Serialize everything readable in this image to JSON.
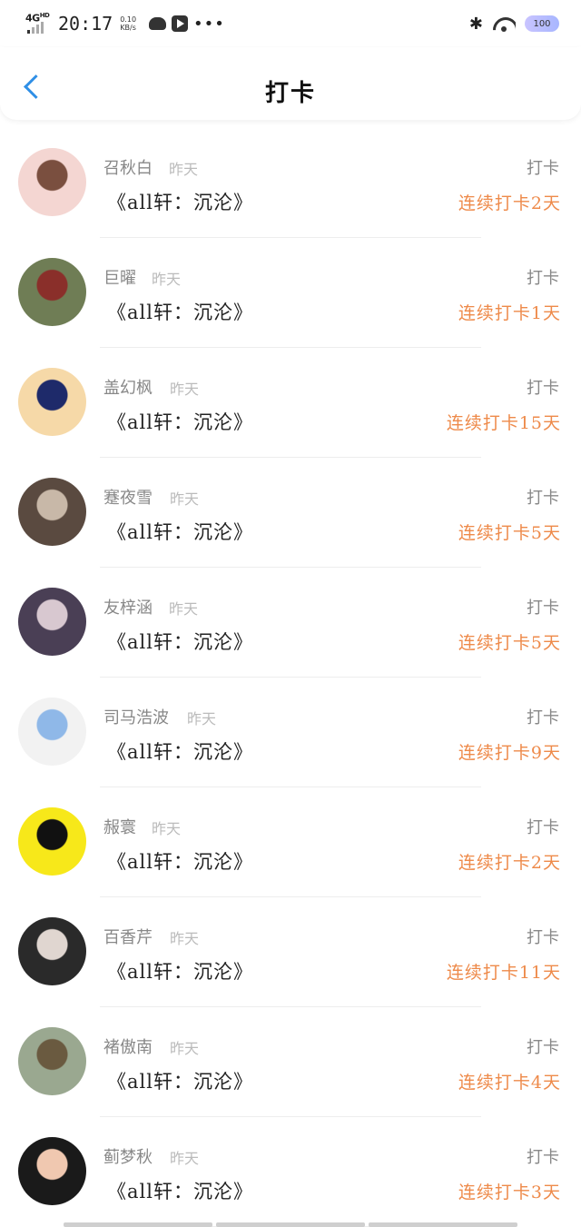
{
  "status_bar": {
    "network": "4G",
    "network_sub": "HD",
    "time": "20:17",
    "speed_value": "0.10",
    "speed_unit": "KB/s",
    "more": "•••",
    "bluetooth": "✱",
    "battery": "100"
  },
  "header": {
    "title": "打卡",
    "back_icon": "chevron-left-icon",
    "accent_color": "#2f8fe6"
  },
  "streak_color": "#ee8a4a",
  "items": [
    {
      "name": "召秋白",
      "time": "昨天",
      "book": "《all轩：沉沦》",
      "label": "打卡",
      "streak": "连续打卡2天",
      "avatar_colors": [
        "#f4d6d2",
        "#7a4f3f"
      ]
    },
    {
      "name": "巨曜",
      "time": "昨天",
      "book": "《all轩：沉沦》",
      "label": "打卡",
      "streak": "连续打卡1天",
      "avatar_colors": [
        "#6f7d55",
        "#8a2f2a"
      ]
    },
    {
      "name": "盖幻枫",
      "time": "昨天",
      "book": "《all轩：沉沦》",
      "label": "打卡",
      "streak": "连续打卡15天",
      "avatar_colors": [
        "#f6d9a8",
        "#1e2a6a"
      ]
    },
    {
      "name": "蹇夜雪",
      "time": "昨天",
      "book": "《all轩：沉沦》",
      "label": "打卡",
      "streak": "连续打卡5天",
      "avatar_colors": [
        "#5a4a40",
        "#c8b8a8"
      ]
    },
    {
      "name": "友梓涵",
      "time": "昨天",
      "book": "《all轩：沉沦》",
      "label": "打卡",
      "streak": "连续打卡5天",
      "avatar_colors": [
        "#4a3f55",
        "#d8c8d0"
      ]
    },
    {
      "name": "司马浩波",
      "time": "昨天",
      "book": "《all轩：沉沦》",
      "label": "打卡",
      "streak": "连续打卡9天",
      "avatar_colors": [
        "#f2f2f2",
        "#8fb8e8"
      ]
    },
    {
      "name": "赧寰",
      "time": "昨天",
      "book": "《all轩：沉沦》",
      "label": "打卡",
      "streak": "连续打卡2天",
      "avatar_colors": [
        "#f7e81a",
        "#111111"
      ]
    },
    {
      "name": "百香芹",
      "time": "昨天",
      "book": "《all轩：沉沦》",
      "label": "打卡",
      "streak": "连续打卡11天",
      "avatar_colors": [
        "#2a2a2a",
        "#e0d6d0"
      ]
    },
    {
      "name": "褚傲南",
      "time": "昨天",
      "book": "《all轩：沉沦》",
      "label": "打卡",
      "streak": "连续打卡4天",
      "avatar_colors": [
        "#9aa890",
        "#6a5a40"
      ]
    },
    {
      "name": "蓟梦秋",
      "time": "昨天",
      "book": "《all轩：沉沦》",
      "label": "打卡",
      "streak": "连续打卡3天",
      "avatar_colors": [
        "#1a1a1a",
        "#f0c8b0"
      ]
    }
  ]
}
